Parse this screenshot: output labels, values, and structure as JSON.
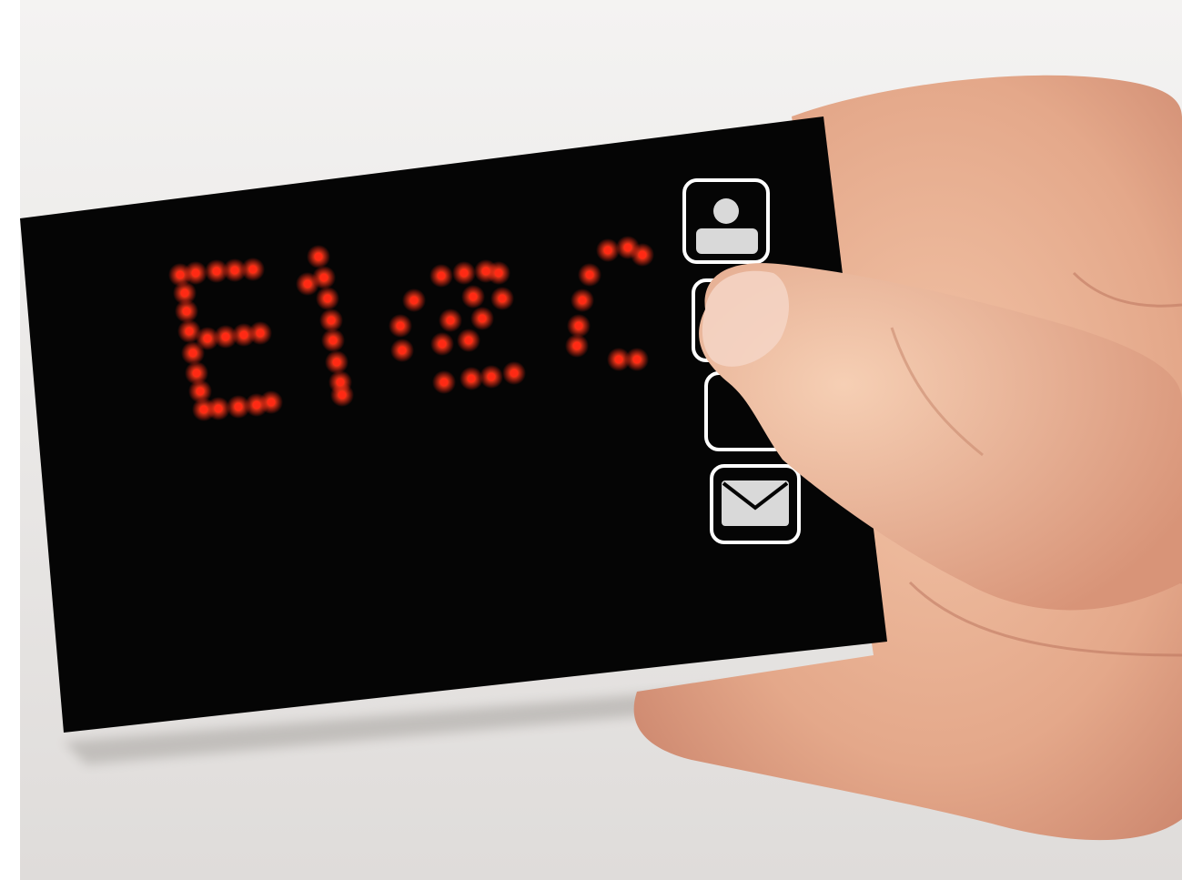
{
  "photo": {
    "subject": "",
    "colors": {
      "background_top": "#f4f3f2",
      "background_bottom": "#dfdcda",
      "card": "#050505",
      "led": "#ff2a14",
      "led_glow": "#ff3a1a",
      "skin_light": "#f2c3a6",
      "skin_mid": "#e4a88a",
      "skin_shadow": "#c9826a",
      "icon_fill": "#d9d9d9",
      "icon_border": "#ffffff"
    },
    "card": {
      "display_text": "",
      "icons": [
        {
          "name": "person-icon"
        },
        {
          "name": "phone-icon"
        },
        {
          "name": "globe-icon"
        },
        {
          "name": "envelope-icon"
        }
      ]
    }
  }
}
